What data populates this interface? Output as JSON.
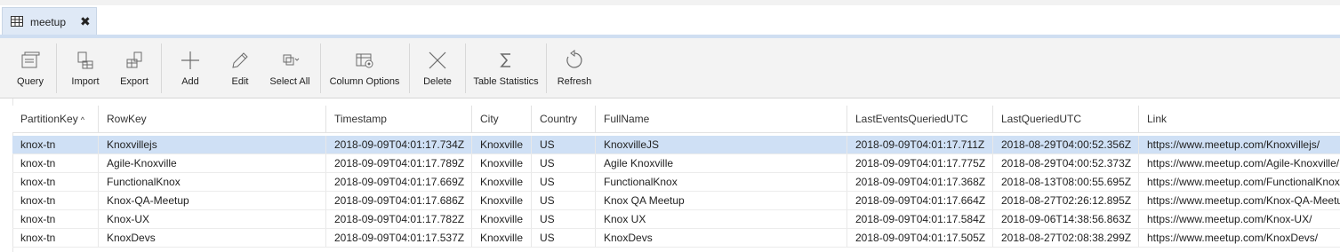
{
  "tab": {
    "title": "meetup",
    "close": "✖"
  },
  "toolbar": {
    "buttons": [
      {
        "label": "Query",
        "icon": "query-icon"
      },
      {
        "label": "Import",
        "icon": "import-icon"
      },
      {
        "label": "Export",
        "icon": "export-icon"
      },
      {
        "label": "Add",
        "icon": "add-icon"
      },
      {
        "label": "Edit",
        "icon": "edit-icon"
      },
      {
        "label": "Select All",
        "icon": "select-all-icon"
      },
      {
        "label": "Column Options",
        "icon": "column-options-icon"
      },
      {
        "label": "Delete",
        "icon": "delete-icon"
      },
      {
        "label": "Table Statistics",
        "icon": "sigma-icon"
      },
      {
        "label": "Refresh",
        "icon": "refresh-icon"
      }
    ]
  },
  "table": {
    "sort_indicator": "^",
    "columns": [
      "PartitionKey",
      "RowKey",
      "Timestamp",
      "City",
      "Country",
      "FullName",
      "LastEventsQueriedUTC",
      "LastQueriedUTC",
      "Link"
    ],
    "rows": [
      [
        "knox-tn",
        "Knoxvillejs",
        "2018-09-09T04:01:17.734Z",
        "Knoxville",
        "US",
        "KnoxvilleJS",
        "2018-09-09T04:01:17.711Z",
        "2018-08-29T04:00:52.356Z",
        "https://www.meetup.com/Knoxvillejs/"
      ],
      [
        "knox-tn",
        "Agile-Knoxville",
        "2018-09-09T04:01:17.789Z",
        "Knoxville",
        "US",
        "Agile Knoxville",
        "2018-09-09T04:01:17.775Z",
        "2018-08-29T04:00:52.373Z",
        "https://www.meetup.com/Agile-Knoxville/"
      ],
      [
        "knox-tn",
        "FunctionalKnox",
        "2018-09-09T04:01:17.669Z",
        "Knoxville",
        "US",
        "FunctionalKnox",
        "2018-09-09T04:01:17.368Z",
        "2018-08-13T08:00:55.695Z",
        "https://www.meetup.com/FunctionalKnox/"
      ],
      [
        "knox-tn",
        "Knox-QA-Meetup",
        "2018-09-09T04:01:17.686Z",
        "Knoxville",
        "US",
        "Knox QA Meetup",
        "2018-09-09T04:01:17.664Z",
        "2018-08-27T02:26:12.895Z",
        "https://www.meetup.com/Knox-QA-Meetup/"
      ],
      [
        "knox-tn",
        "Knox-UX",
        "2018-09-09T04:01:17.782Z",
        "Knoxville",
        "US",
        "Knox UX",
        "2018-09-09T04:01:17.584Z",
        "2018-09-06T14:38:56.863Z",
        "https://www.meetup.com/Knox-UX/"
      ],
      [
        "knox-tn",
        "KnoxDevs",
        "2018-09-09T04:01:17.537Z",
        "Knoxville",
        "US",
        "KnoxDevs",
        "2018-09-09T04:01:17.505Z",
        "2018-08-27T02:08:38.299Z",
        "https://www.meetup.com/KnoxDevs/"
      ]
    ],
    "selected_row": 0
  },
  "colors": {
    "accent": "#cfe0f5",
    "tab_bg": "#dfe9f6",
    "toolbar_bg": "#f3f3f3",
    "icon": "#6b6b6b"
  }
}
